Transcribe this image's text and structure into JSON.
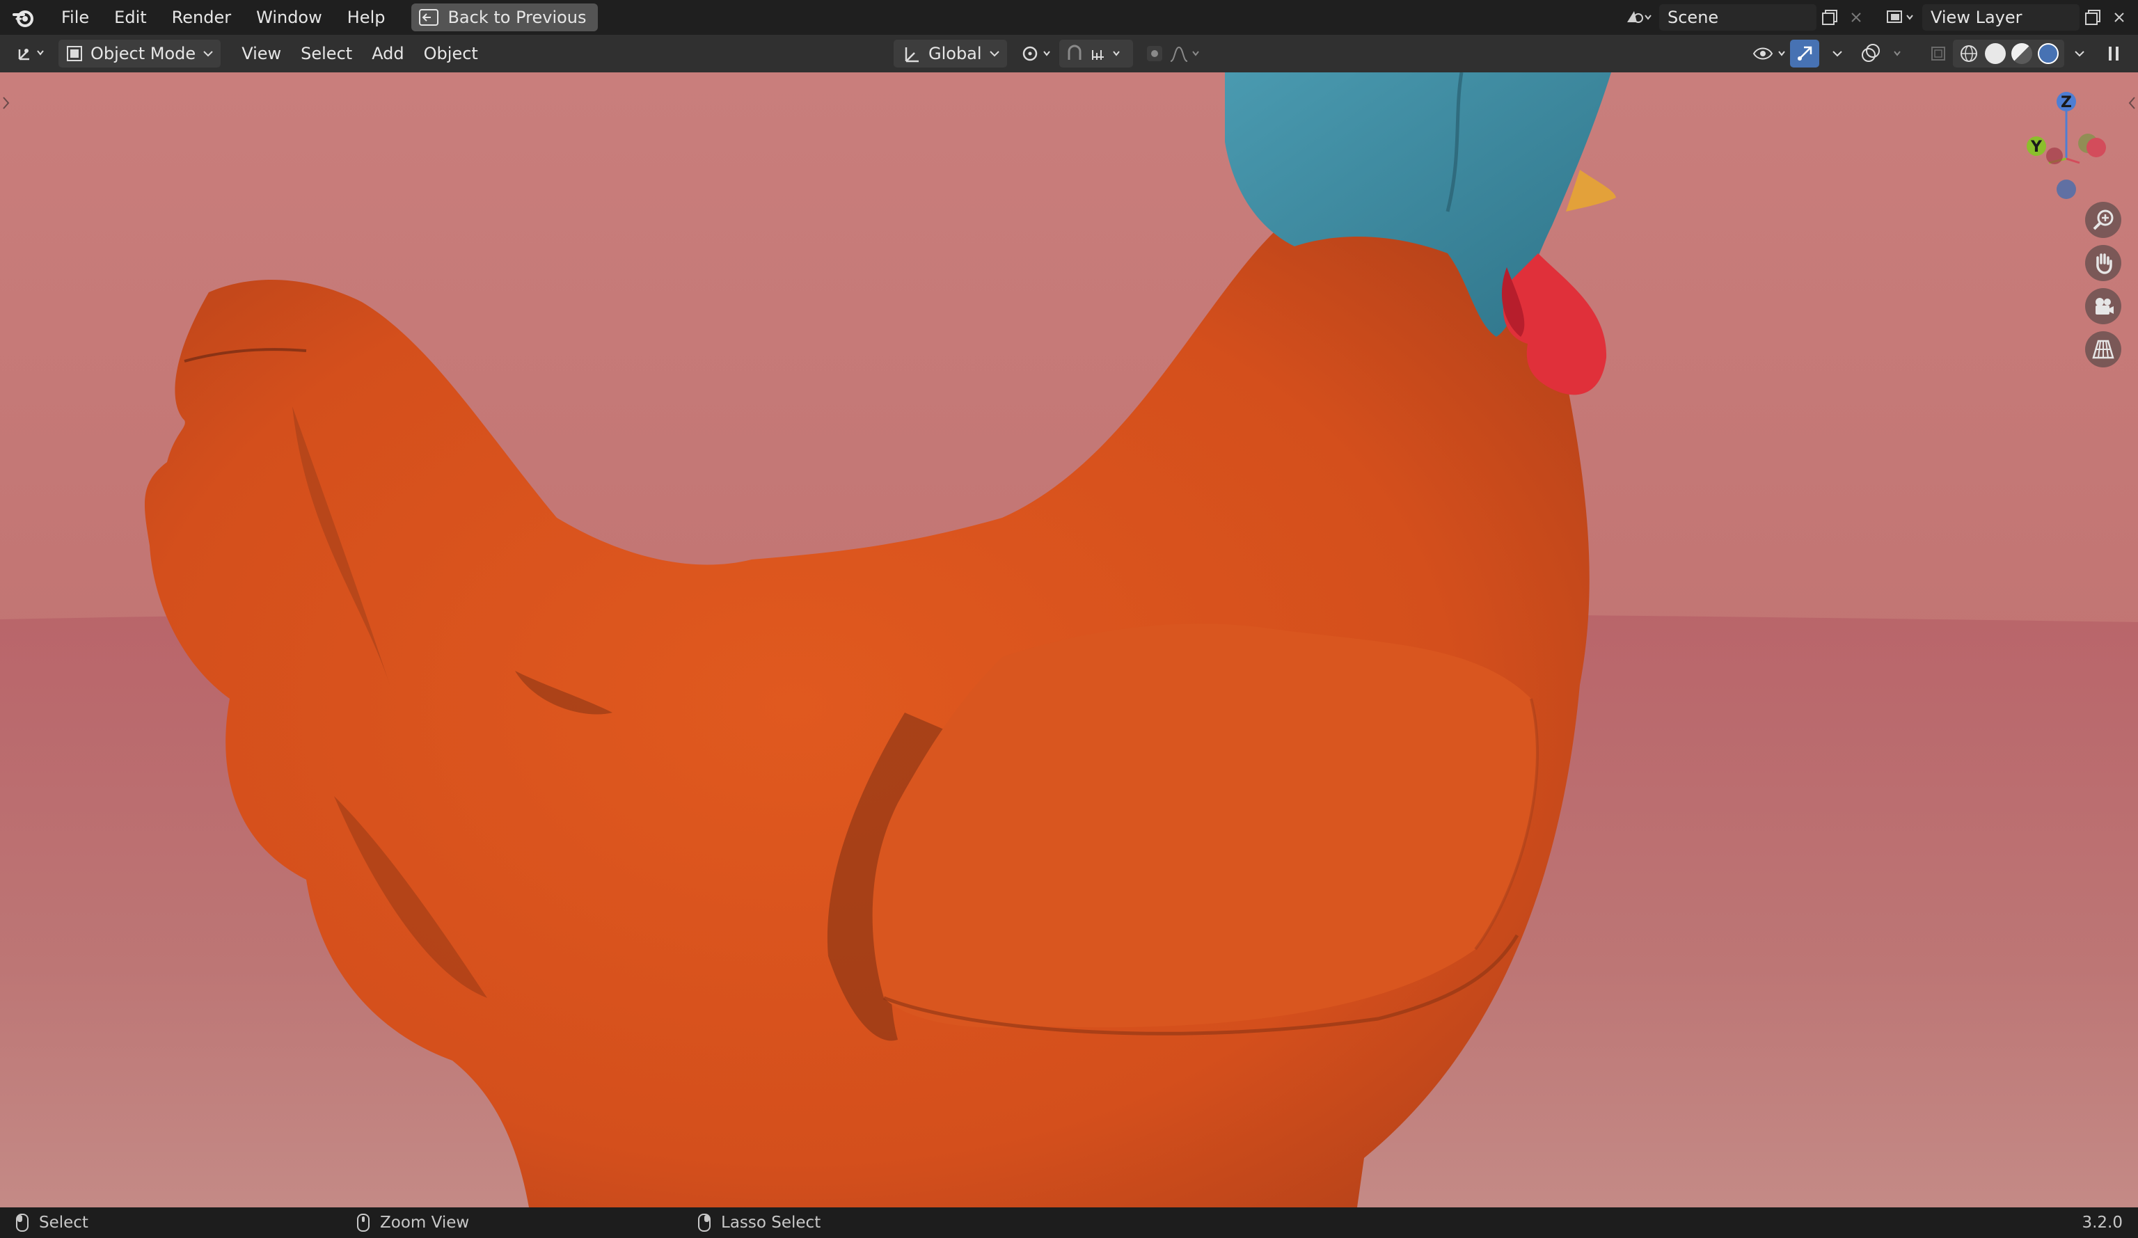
{
  "topbar": {
    "menus": [
      "File",
      "Edit",
      "Render",
      "Window",
      "Help"
    ],
    "back_button": "Back to Previous",
    "scene": "Scene",
    "view_layer": "View Layer"
  },
  "header": {
    "mode": "Object Mode",
    "menus": [
      "View",
      "Select",
      "Add",
      "Object"
    ],
    "orientation": "Global"
  },
  "gizmo": {
    "z": "Z",
    "y": "Y"
  },
  "status": {
    "select": "Select",
    "zoom": "Zoom View",
    "lasso": "Lasso Select",
    "version": "3.2.0"
  },
  "colors": {
    "background": "#c47a78",
    "floor": "#b96e6c",
    "chicken_body": "#d9521f",
    "hat": "#3d8ca0",
    "comb": "#e0303a",
    "beak": "#e3a13a",
    "accent": "#4772b3"
  },
  "icons": [
    "blender-logo-icon",
    "back-icon",
    "editor-type-icon",
    "object-mode-icon",
    "orientation-icon",
    "pivot-icon",
    "snap-icon",
    "proportional-icon",
    "visibility-icon",
    "gizmo-icon",
    "overlay-icon",
    "xray-icon",
    "wireframe-icon",
    "solid-icon",
    "material-icon",
    "rendered-icon",
    "zoom-icon",
    "hand-icon",
    "camera-icon",
    "grid-icon",
    "mouse-icon"
  ]
}
